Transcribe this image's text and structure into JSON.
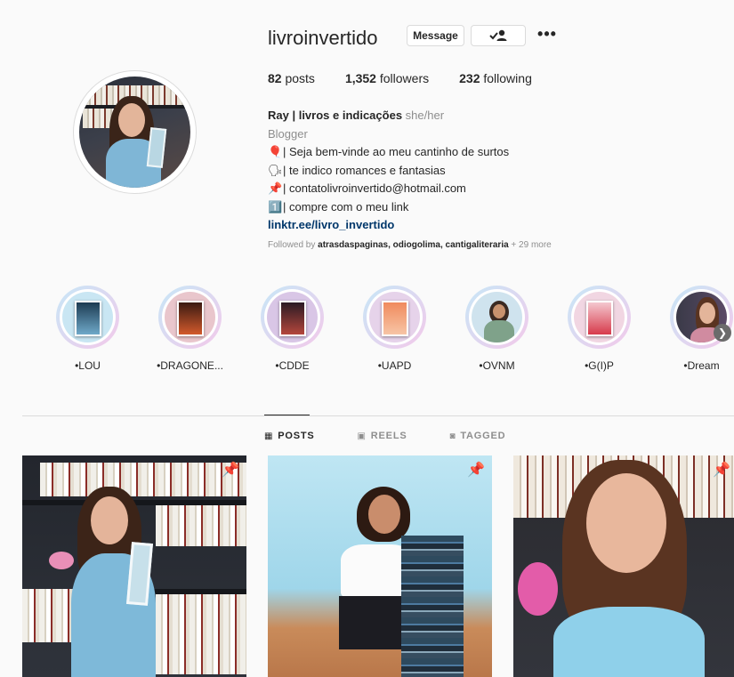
{
  "profile": {
    "username": "livroinvertido",
    "message_label": "Message",
    "follow_icon": "person-check-icon",
    "more_label": "•••"
  },
  "stats": {
    "posts_count": "82",
    "posts_label": " posts",
    "followers_count": "1,352",
    "followers_label": " followers",
    "following_count": "232",
    "following_label": " following"
  },
  "bio": {
    "name": "Ray | livros e indicações",
    "pronouns": "she/her",
    "category": "Blogger",
    "lines": [
      {
        "emoji": "🎈",
        "text": "| Seja bem-vinde ao meu cantinho de surtos"
      },
      {
        "emoji": "🗣",
        "text": "| te indico romances e fantasias"
      },
      {
        "emoji": "📌",
        "text": "| contatolivroinvertido@hotmail.com"
      },
      {
        "emoji": "1️⃣",
        "text": "| compre com o meu link"
      }
    ],
    "link": "linktr.ee/livro_invertido"
  },
  "followed_by": {
    "prefix": "Followed by ",
    "names": "atrasdaspaginas, odiogolima, cantigaliteraria",
    "suffix": " + 29 more"
  },
  "highlights": [
    {
      "label": "•LOU",
      "colors": [
        "#1d3b52",
        "#6fa9c9"
      ]
    },
    {
      "label": "•DRAGONE...",
      "colors": [
        "#3a1a12",
        "#d25a2c"
      ]
    },
    {
      "label": "•CDDE",
      "colors": [
        "#2a1a24",
        "#b4473c"
      ]
    },
    {
      "label": "•UAPD",
      "colors": [
        "#f08a5d",
        "#f7c5a6"
      ]
    },
    {
      "label": "•OVNM",
      "colors": [
        "#3b2a22",
        "#7fa28a"
      ]
    },
    {
      "label": "•G(I)P",
      "colors": [
        "#f4c7cf",
        "#d73b4b"
      ]
    },
    {
      "label": "•Dream",
      "colors": [
        "#2a2a33",
        "#d08ba0"
      ]
    }
  ],
  "tabs": [
    {
      "label": "POSTS",
      "icon": "grid-icon",
      "glyph": "▦"
    },
    {
      "label": "REELS",
      "icon": "reels-icon",
      "glyph": "▣"
    },
    {
      "label": "TAGGED",
      "icon": "tagged-icon",
      "glyph": "◙"
    }
  ],
  "posts": [
    {
      "pinned": true
    },
    {
      "pinned": true
    },
    {
      "pinned": true
    }
  ]
}
